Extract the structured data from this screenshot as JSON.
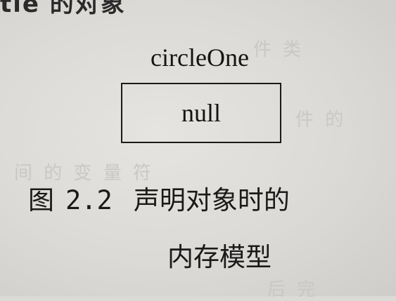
{
  "heading_fragment": "tle 的对象",
  "diagram": {
    "variable_name": "circleOne",
    "value": "null"
  },
  "caption": {
    "label": "图",
    "number": "2.2",
    "text_line1": "声明对象时的",
    "text_line2": "内存模型"
  }
}
